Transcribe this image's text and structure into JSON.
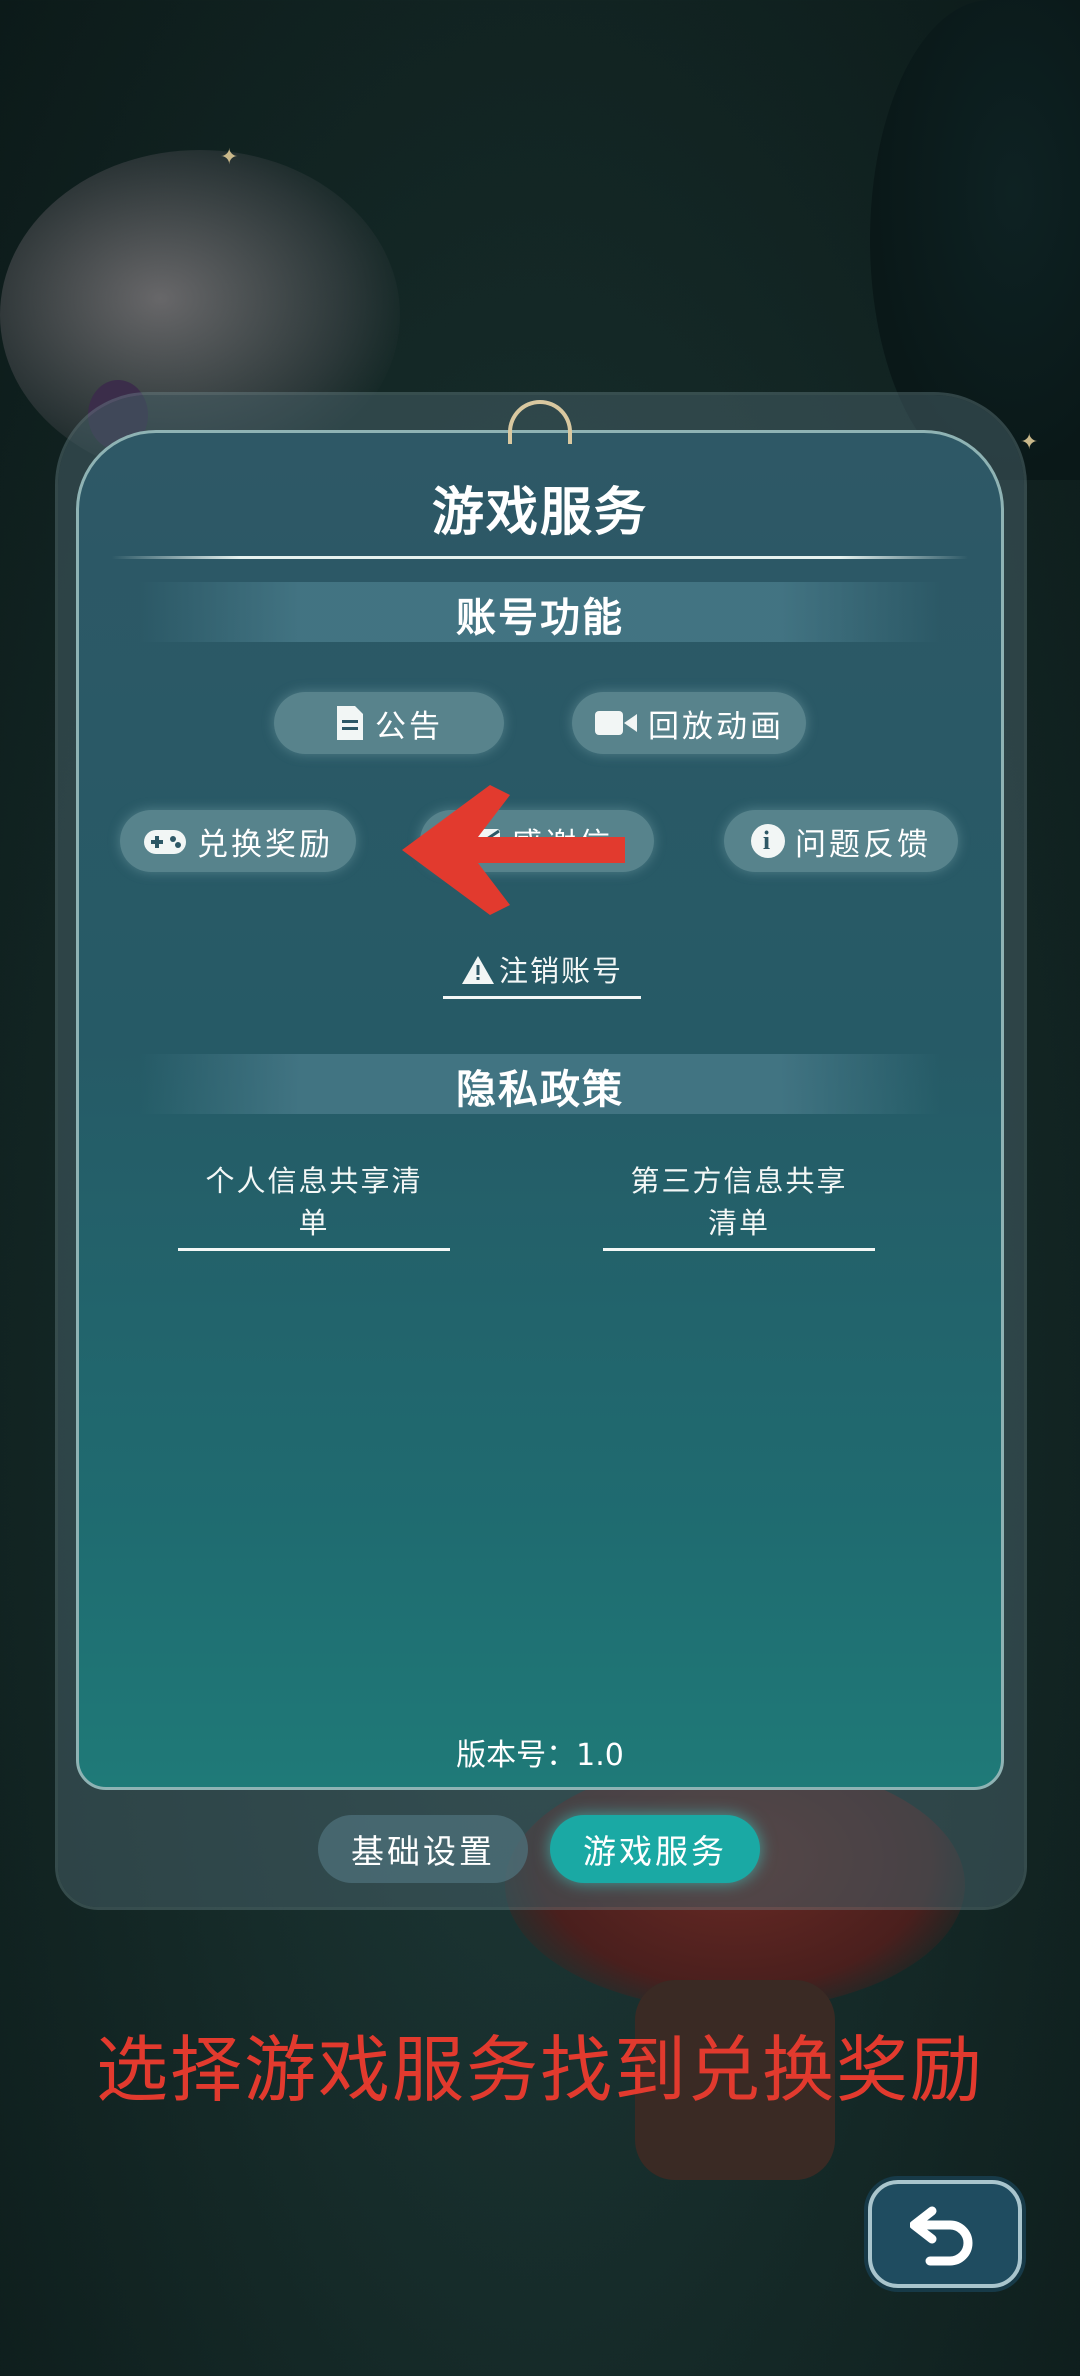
{
  "dialog": {
    "title": "游戏服务",
    "account_section": {
      "heading": "账号功能",
      "buttons": {
        "announcement": "公告",
        "replay": "回放动画",
        "redeem": "兑换奖励",
        "thanks_letter": "感谢信",
        "feedback": "问题反馈"
      },
      "cancel_account": "注销账号"
    },
    "privacy_section": {
      "heading": "隐私政策",
      "links": {
        "personal_info": "个人信息共享清单",
        "third_party": "第三方信息共享清单"
      }
    },
    "version": "版本号：1.0",
    "tabs": {
      "basic_settings": "基础设置",
      "game_services": "游戏服务",
      "active": "游戏服务"
    }
  },
  "overlay": {
    "instruction": "选择游戏服务找到兑换奖励",
    "arrow_color": "#e23a2e"
  },
  "icons": {
    "announcement": "document-icon",
    "replay": "video-camera-icon",
    "redeem": "gamepad-icon",
    "thanks_letter": "envelope-icon",
    "feedback": "info-icon",
    "cancel_account": "warning-icon",
    "back": "back-arrow-icon"
  }
}
